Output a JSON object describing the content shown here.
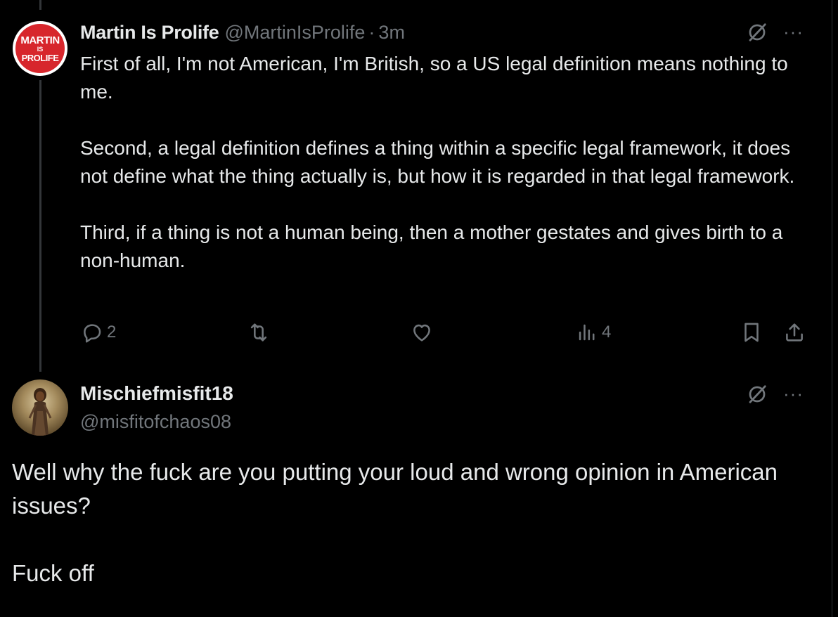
{
  "colors": {
    "background": "#000000",
    "text": "#e7e9ea",
    "secondary_text": "#71767b",
    "thread_line": "#333639",
    "avatar_red": "#d7262c"
  },
  "tweet1": {
    "avatar": {
      "line1": "MARTIN",
      "line2": "IS",
      "line3": "PROLIFE"
    },
    "display_name": "Martin Is Prolife",
    "handle": "@MartinIsProlife",
    "separator": "·",
    "time": "3m",
    "paragraphs": [
      "First of all, I'm not American, I'm British, so a US legal definition means nothing to me.",
      "Second, a legal definition defines a thing within a specific legal framework, it does not define what the thing actually is, but how it is regarded in that legal framework.",
      "Third, if a thing is not a human being, then a mother gestates and gives birth to a non-human."
    ],
    "actions": {
      "reply_count": "2",
      "views_count": "4"
    },
    "icons": [
      "grok-icon",
      "more-icon",
      "reply-icon",
      "retweet-icon",
      "like-icon",
      "views-icon",
      "bookmark-icon",
      "share-icon"
    ]
  },
  "tweet2": {
    "display_name": "Mischiefmisfit18",
    "handle": "@misfitofchaos08",
    "paragraphs": [
      "Well why the fuck are you putting your loud and wrong opinion in American issues?",
      "Fuck off"
    ],
    "icons": [
      "grok-icon",
      "more-icon"
    ]
  },
  "more_glyph": "···"
}
